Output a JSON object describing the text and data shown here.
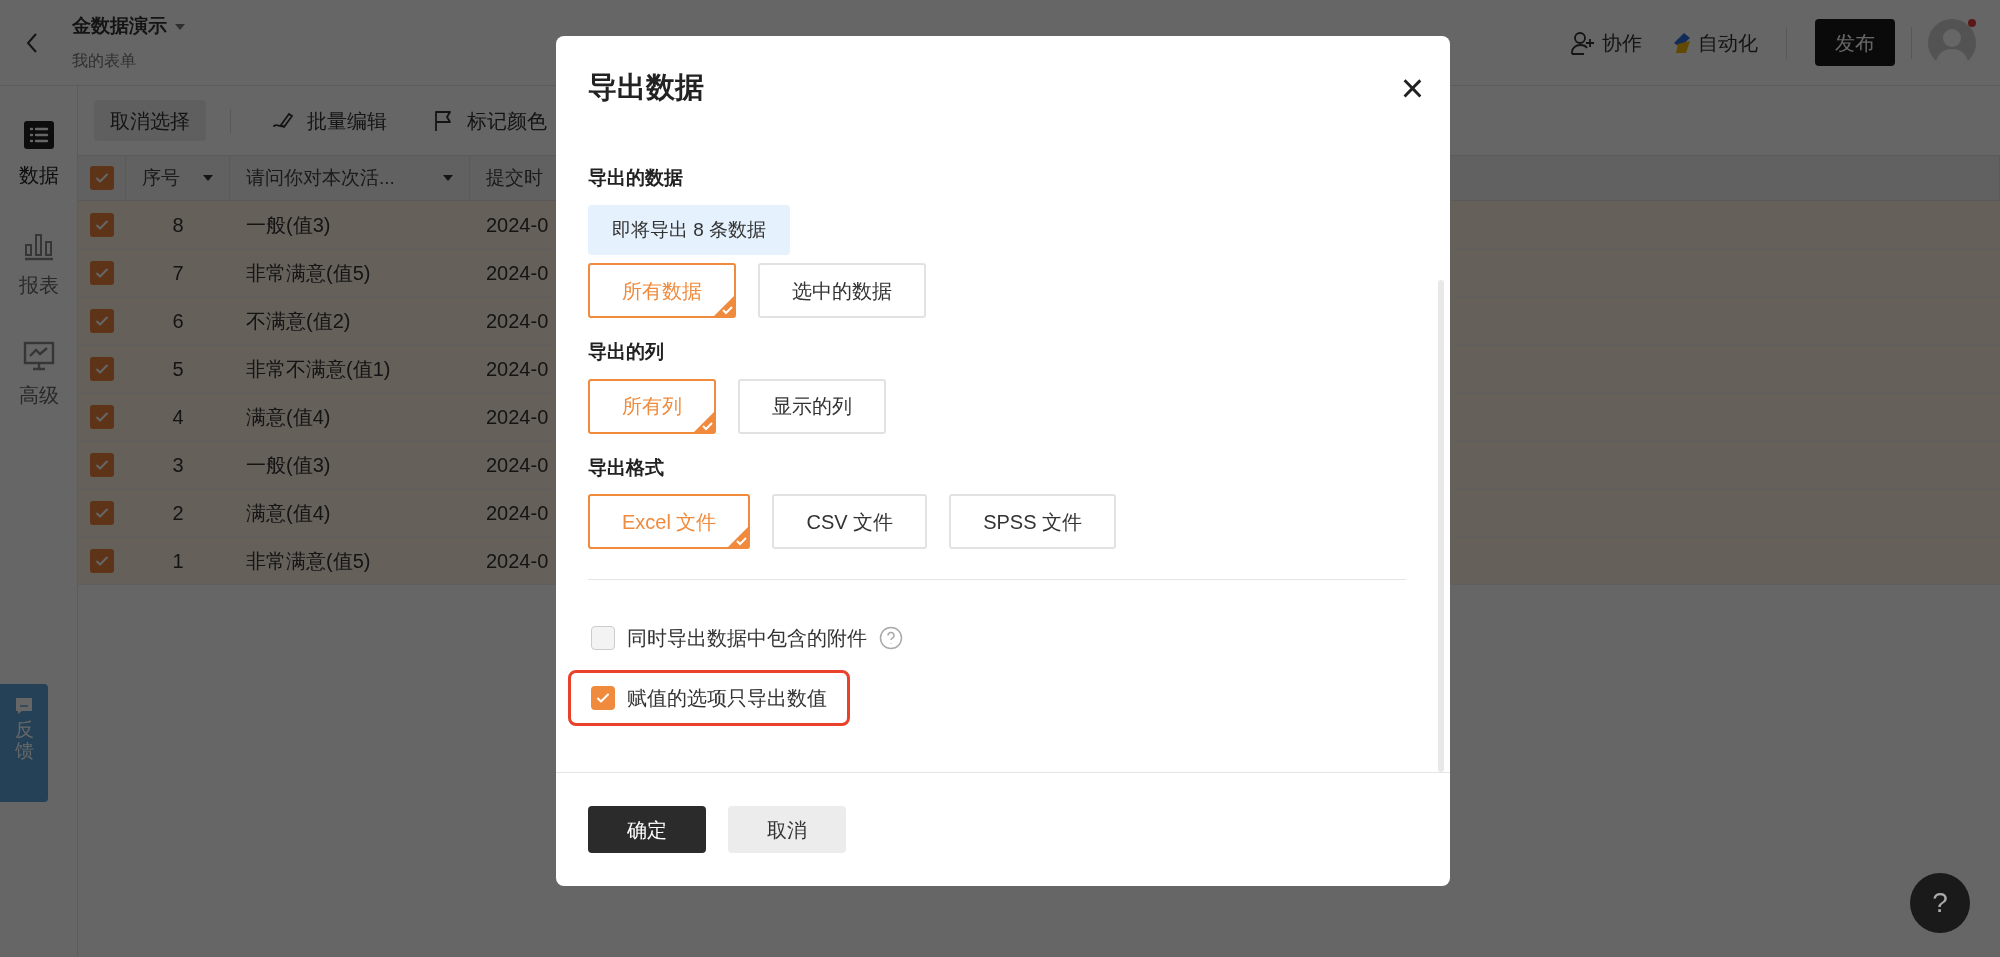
{
  "header": {
    "title": "金数据演示",
    "subtitle": "我的表单",
    "actions": [
      {
        "kind": "collab",
        "label": "协作"
      },
      {
        "kind": "automation",
        "label": "自动化"
      }
    ],
    "publish_button": "发布",
    "has_notification": true
  },
  "sidebar": {
    "items": [
      {
        "kind": "data",
        "label": "数据",
        "selected": true
      },
      {
        "kind": "report",
        "label": "报表",
        "selected": false
      },
      {
        "kind": "advanced",
        "label": "高级",
        "selected": false
      }
    ]
  },
  "toolbar": [
    {
      "kind": "plain",
      "label": "取消选择"
    },
    {
      "kind": "edit",
      "label": "批量编辑"
    },
    {
      "kind": "flag",
      "label": "标记颜色"
    }
  ],
  "table": {
    "all_selected": true,
    "columns": [
      {
        "label": "序号",
        "sortable": true
      },
      {
        "label": "请问你对本次活...",
        "sortable": true
      },
      {
        "label": "提交时",
        "sortable": false
      }
    ],
    "rows": [
      {
        "selected": true,
        "cells": [
          "8",
          "一般(值3)",
          "2024-0"
        ]
      },
      {
        "selected": true,
        "cells": [
          "7",
          "非常满意(值5)",
          "2024-0"
        ]
      },
      {
        "selected": true,
        "cells": [
          "6",
          "不满意(值2)",
          "2024-0"
        ]
      },
      {
        "selected": true,
        "cells": [
          "5",
          "非常不满意(值1)",
          "2024-0"
        ]
      },
      {
        "selected": true,
        "cells": [
          "4",
          "满意(值4)",
          "2024-0"
        ]
      },
      {
        "selected": true,
        "cells": [
          "3",
          "一般(值3)",
          "2024-0"
        ]
      },
      {
        "selected": true,
        "cells": [
          "2",
          "满意(值4)",
          "2024-0"
        ]
      },
      {
        "selected": true,
        "cells": [
          "1",
          "非常满意(值5)",
          "2024-0"
        ]
      }
    ]
  },
  "dialog": {
    "title": "导出数据",
    "close": "×",
    "sections": [
      {
        "label": "导出的数据",
        "info": "即将导出 8 条数据",
        "options": [
          {
            "label": "所有数据",
            "selected": true
          },
          {
            "label": "选中的数据",
            "selected": false
          }
        ]
      },
      {
        "label": "导出的列",
        "options": [
          {
            "label": "所有列",
            "selected": true
          },
          {
            "label": "显示的列",
            "selected": false
          }
        ]
      },
      {
        "label": "导出格式",
        "options": [
          {
            "label": "Excel 文件",
            "selected": true
          },
          {
            "label": "CSV 文件",
            "selected": false
          },
          {
            "label": "SPSS 文件",
            "selected": false
          }
        ]
      }
    ],
    "checkboxes": [
      {
        "label": "同时导出数据中包含的附件",
        "checked": false,
        "help": true,
        "highlighted": false
      },
      {
        "label": "赋值的选项只导出数值",
        "checked": true,
        "help": false,
        "highlighted": true
      }
    ],
    "buttons": [
      {
        "kind": "primary",
        "label": "确定"
      },
      {
        "kind": "secondary",
        "label": "取消"
      }
    ]
  },
  "feedback_tab": {
    "label": "反馈"
  },
  "help_button": {
    "label": "?"
  }
}
